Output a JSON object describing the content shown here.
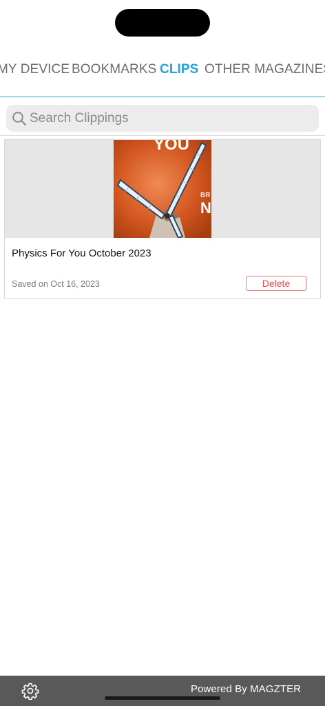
{
  "tabs": [
    {
      "label": "MY DEVICE",
      "active": false
    },
    {
      "label": "BOOKMARKS",
      "active": false
    },
    {
      "label": "CLIPS",
      "active": true
    },
    {
      "label": "OTHER MAGAZINES",
      "active": false
    }
  ],
  "accent_color": "#22a1dd",
  "search": {
    "placeholder": "Search Clippings",
    "value": "",
    "icon": "search-icon"
  },
  "clips": [
    {
      "title": "Physics For You October 2023",
      "saved_label": "Saved on Oct 16, 2023",
      "delete_label": "Delete",
      "cover_text": {
        "top": "YOU",
        "right_small": "BR",
        "right_big": "NI"
      }
    }
  ],
  "footer": {
    "settings_icon": "gear-icon",
    "powered_by": "Powered By MAGZTER"
  }
}
